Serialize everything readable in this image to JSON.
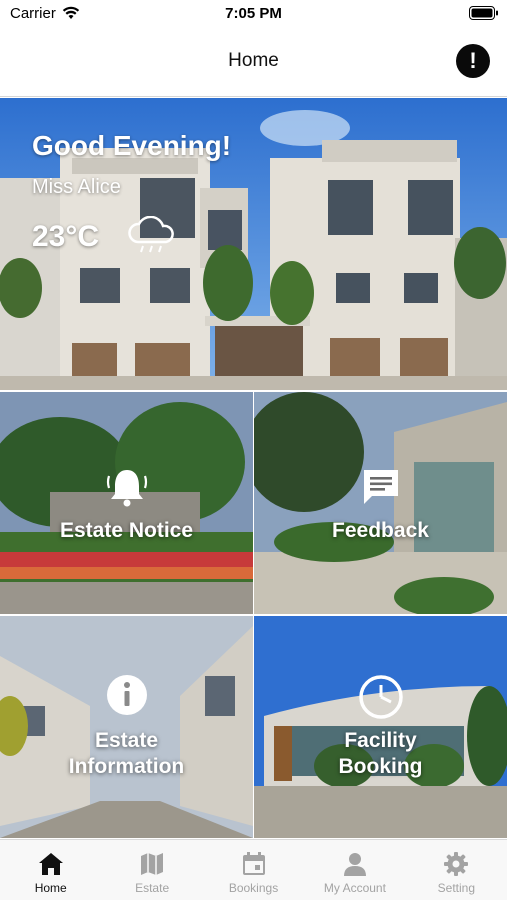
{
  "status": {
    "carrier": "Carrier",
    "time": "7:05 PM"
  },
  "nav": {
    "title": "Home",
    "alert_symbol": "!"
  },
  "hero": {
    "greeting": "Good Evening!",
    "user_name": "Miss Alice",
    "temperature": "23°C",
    "weather_icon": "cloud-rain-icon"
  },
  "tiles": [
    {
      "label": "Estate Notice",
      "icon": "bell-icon"
    },
    {
      "label": "Feedback",
      "icon": "chat-icon"
    },
    {
      "label": "Estate Information",
      "icon": "info-icon"
    },
    {
      "label": "Facility Booking",
      "icon": "clock-icon"
    }
  ],
  "tabbar": {
    "items": [
      {
        "label": "Home",
        "icon": "home-icon",
        "active": true
      },
      {
        "label": "Estate",
        "icon": "map-icon",
        "active": false
      },
      {
        "label": "Bookings",
        "icon": "calendar-icon",
        "active": false
      },
      {
        "label": "My Account",
        "icon": "person-icon",
        "active": false
      },
      {
        "label": "Setting",
        "icon": "gear-icon",
        "active": false
      }
    ]
  },
  "colors": {
    "active_tab": "#111111",
    "inactive_tab": "#a3a3a3",
    "sky": "#3d7fd6"
  }
}
